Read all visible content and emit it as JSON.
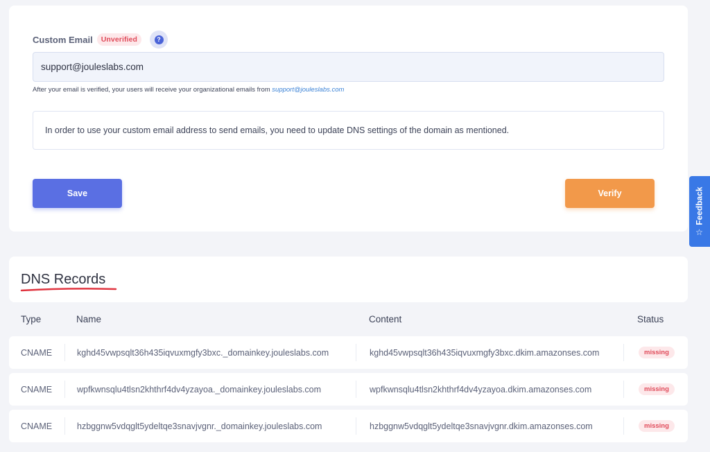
{
  "email": {
    "label": "Custom Email",
    "badge": "Unverified",
    "help_icon": "question-circle-icon",
    "value": "support@jouleslabs.com",
    "helper_text": "After your email is verified, your users will receive your organizational emails from",
    "helper_link": "support@jouleslabs.com",
    "info": "In order to use your custom email address to send emails, you need to update DNS settings of the domain as mentioned.",
    "save_label": "Save",
    "verify_label": "Verify"
  },
  "feedback": {
    "label": "Feedback",
    "icon": "star-icon"
  },
  "dns": {
    "title": "DNS Records",
    "columns": {
      "type": "Type",
      "name": "Name",
      "content": "Content",
      "status": "Status"
    },
    "records": [
      {
        "type": "CNAME",
        "name": "kghd45vwpsqlt36h435iqvuxmgfy3bxc._domainkey.jouleslabs.com",
        "content": "kghd45vwpsqlt36h435iqvuxmgfy3bxc.dkim.amazonses.com",
        "status": "missing"
      },
      {
        "type": "CNAME",
        "name": "wpfkwnsqlu4tlsn2khthrf4dv4yzayoa._domainkey.jouleslabs.com",
        "content": "wpfkwnsqlu4tlsn2khthrf4dv4yzayoa.dkim.amazonses.com",
        "status": "missing"
      },
      {
        "type": "CNAME",
        "name": "hzbggnw5vdqglt5ydeltqe3snavjvgnr._domainkey.jouleslabs.com",
        "content": "hzbggnw5vdqglt5ydeltqe3snavjvgnr.dkim.amazonses.com",
        "status": "missing"
      }
    ]
  },
  "colors": {
    "primary": "#5a6fe3",
    "verify": "#f2994a",
    "danger": "#e04b5a",
    "feedback": "#3978e6"
  }
}
